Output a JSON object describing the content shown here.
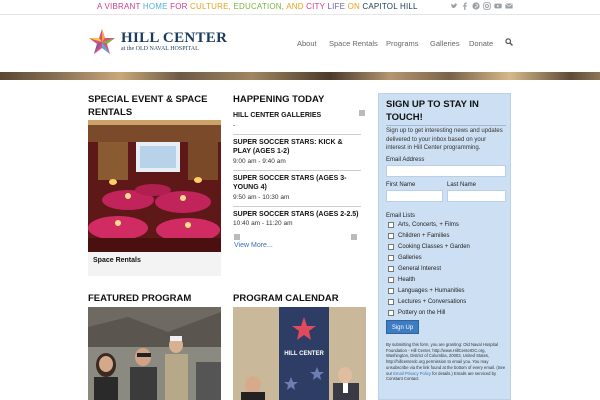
{
  "topbar": {
    "tagline_parts": [
      {
        "text": "A VIBRANT ",
        "color": "#d23b8a"
      },
      {
        "text": "HOME",
        "color": "#4fb3d9"
      },
      {
        "text": " FOR ",
        "color": "#d23b8a"
      },
      {
        "text": "CULTURE, ",
        "color": "#e6a21c"
      },
      {
        "text": "EDUCATION, ",
        "color": "#7bb53a"
      },
      {
        "text": "AND ",
        "color": "#e6a21c"
      },
      {
        "text": "CITY ",
        "color": "#d23b8a"
      },
      {
        "text": "LIFE",
        "color": "#7b5ea7"
      },
      {
        "text": " ON ",
        "color": "#e6a21c"
      },
      {
        "text": "CAPITOL HILL",
        "color": "#1b3a5c"
      }
    ],
    "social_icons": [
      "twitter-icon",
      "facebook-icon",
      "pinterest-icon",
      "instagram-icon",
      "youtube-icon",
      "email-icon"
    ]
  },
  "header": {
    "logo_name": "HILL CENTER",
    "logo_sub": "at the OLD NAVAL HOSPITAL",
    "nav": [
      "About",
      "Space Rentals",
      "Programs",
      "Galleries",
      "Donate"
    ]
  },
  "col1": {
    "title": "SPECIAL EVENT & SPACE RENTALS",
    "caption": "Space Rentals"
  },
  "col2": {
    "title": "HAPPENING TODAY",
    "events": [
      {
        "title": "HILL CENTER GALLERIES",
        "time": "-"
      },
      {
        "title": "SUPER SOCCER STARS: KICK & PLAY (AGES 1-2)",
        "time": "9:00 am - 9:40 am"
      },
      {
        "title": "SUPER SOCCER STARS (AGES 3-YOUNG 4)",
        "time": "9:50 am - 10:30 am"
      },
      {
        "title": "SUPER SOCCER STARS (AGES 2-2.5)",
        "time": "10:40 am - 11:20 am"
      }
    ],
    "view_more": "View More..."
  },
  "bottom": {
    "featured_title": "FEATURED PROGRAM",
    "calendar_title": "PROGRAM CALENDAR",
    "banner_text": "HILL CENTER"
  },
  "signup": {
    "title": "SIGN UP TO STAY IN TOUCH!",
    "intro": "Sign up to get interesting news and updates delivered to your inbox based on your interest in Hill Center programming.",
    "email_label": "Email Address",
    "first_label": "First Name",
    "last_label": "Last Name",
    "lists_label": "Email Lists",
    "options": [
      "Arts, Concerts, + Films",
      "Children + Families",
      "Cooking Classes + Garden",
      "Galleries",
      "General Interest",
      "Health",
      "Languages + Humanities",
      "Lectures + Conversations",
      "Pottery on the Hill"
    ],
    "button": "Sign Up",
    "fine_a": "By submitting this form, you are granting: Old Naval Hospital Foundation - Hill Center, http://www.HillCenterDC.org, Washington, District of Columbia, 20003, United States, http://hillcenterdc.org permission to email you. You may unsubscribe via the link found at the bottom of every email. (See our ",
    "fine_link1": "Email Privacy Policy",
    "fine_b": " for details.) Emails are serviced by Constant Contact."
  }
}
